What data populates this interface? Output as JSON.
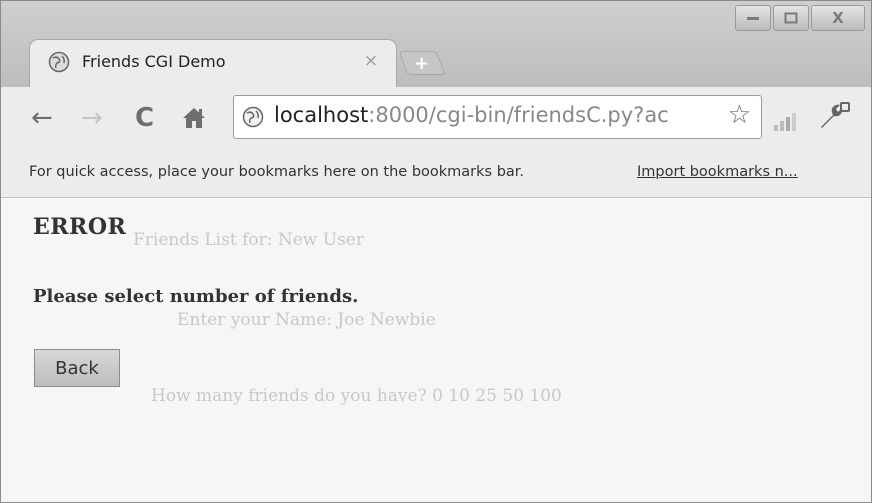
{
  "window": {
    "controls": {
      "minimize_icon": "minimize-icon",
      "maximize_icon": "maximize-icon",
      "close_label": "X"
    }
  },
  "tab": {
    "title": "Friends CGI Demo",
    "close_label": "×",
    "new_tab_label": "+"
  },
  "toolbar": {
    "url_host": "localhost",
    "url_port": ":8000",
    "url_path": "/cgi-bin/friendsC.py?ac",
    "icons": [
      "back-icon",
      "forward-icon",
      "reload-icon",
      "home-icon",
      "star-icon",
      "signal-bars-icon",
      "wrench-icon"
    ]
  },
  "bookmarks_bar": {
    "message": "For quick access, place your bookmarks here on the bookmarks bar.",
    "import_link": "Import bookmarks n..."
  },
  "page": {
    "heading": "ERROR",
    "message": "Please select number of friends.",
    "back_button": "Back"
  },
  "ghost_text": {
    "line1": "Friends List for: New User",
    "line2": "Enter your Name: Joe Newbie",
    "line3": "How many friends do you have? 0 10 25 50 100"
  },
  "colors": {
    "background": "#f6f6f6",
    "chrome": "#ececec",
    "text": "#333333"
  }
}
